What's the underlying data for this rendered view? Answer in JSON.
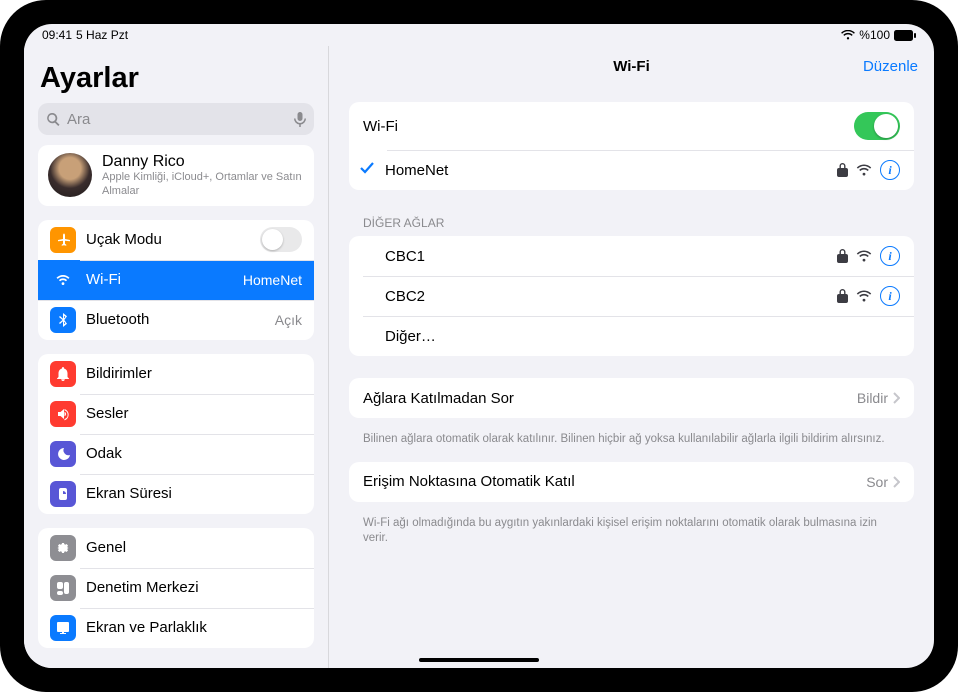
{
  "status": {
    "time": "09:41",
    "date": "5 Haz Pzt",
    "battery": "%100"
  },
  "sidebar": {
    "title": "Ayarlar",
    "search_placeholder": "Ara",
    "user": {
      "name": "Danny Rico",
      "subtitle": "Apple Kimliği, iCloud+, Ortamlar ve Satın Almalar"
    },
    "connectivity": {
      "airplane": "Uçak Modu",
      "wifi": "Wi-Fi",
      "wifi_value": "HomeNet",
      "bluetooth": "Bluetooth",
      "bluetooth_value": "Açık"
    },
    "notif_group": {
      "notifications": "Bildirimler",
      "sounds": "Sesler",
      "focus": "Odak",
      "screentime": "Ekran Süresi"
    },
    "general_group": {
      "general": "Genel",
      "control": "Denetim Merkezi",
      "display": "Ekran ve Parlaklık"
    }
  },
  "main": {
    "title": "Wi-Fi",
    "edit": "Düzenle",
    "wifi_label": "Wi-Fi",
    "connected_network": "HomeNet",
    "other_networks_label": "DİĞER AĞLAR",
    "networks": [
      {
        "name": "CBC1"
      },
      {
        "name": "CBC2"
      }
    ],
    "other_label": "Diğer…",
    "ask_join_label": "Ağlara Katılmadan Sor",
    "ask_join_value": "Bildir",
    "ask_join_footer": "Bilinen ağlara otomatik olarak katılınır. Bilinen hiçbir ağ yoksa kullanılabilir ağlarla ilgili bildirim alırsınız.",
    "auto_hotspot_label": "Erişim Noktasına Otomatik Katıl",
    "auto_hotspot_value": "Sor",
    "auto_hotspot_footer": "Wi-Fi ağı olmadığında bu aygıtın yakınlardaki kişisel erişim noktalarını otomatik olarak bulmasına izin verir."
  }
}
